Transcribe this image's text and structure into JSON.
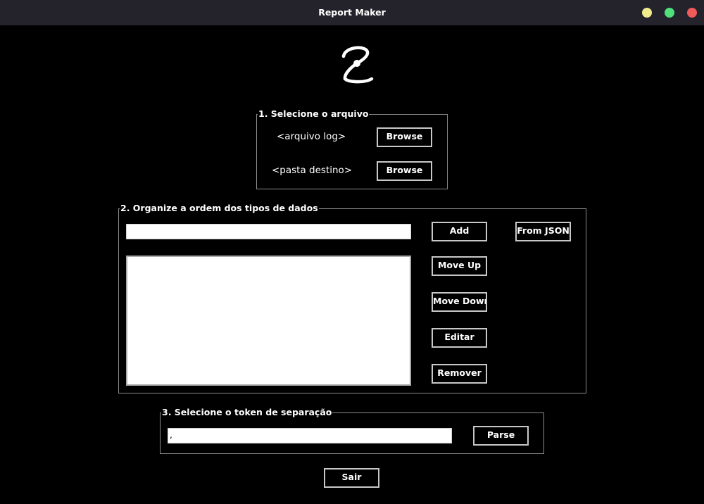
{
  "window": {
    "title": "Report Maker",
    "controls": {
      "minimize_color": "#f0ec8c",
      "maximize_color": "#4fe07c",
      "close_color": "#ef5a5a"
    }
  },
  "logo": {
    "icon": "app-logo-icon"
  },
  "section_file": {
    "legend": "1. Selecione o arquivo",
    "log_label": "<arquivo log>",
    "log_browse": "Browse",
    "dest_label": "<pasta destino>",
    "dest_browse": "Browse"
  },
  "section_order": {
    "legend": "2. Organize a ordem dos tipos de dados",
    "input_value": "",
    "add_label": "Add",
    "from_json_label": "From JSON",
    "move_up_label": "Move Up",
    "move_down_label": "Move Down",
    "edit_label": "Editar",
    "remove_label": "Remover",
    "list_items": []
  },
  "section_token": {
    "legend": "3. Selecione o token de separação",
    "token_value": ",",
    "parse_label": "Parse"
  },
  "footer": {
    "exit_label": "Sair"
  }
}
